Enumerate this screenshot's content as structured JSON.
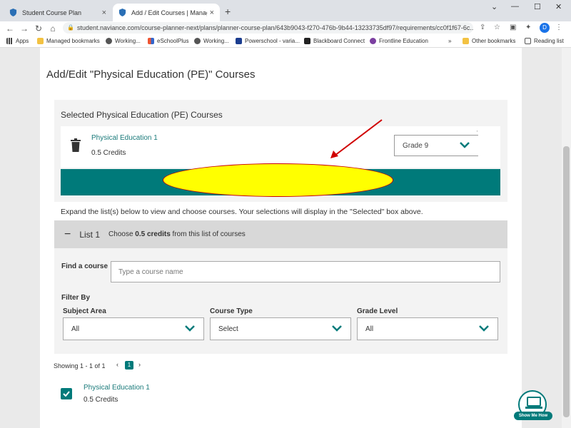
{
  "browser": {
    "tabs": [
      {
        "label": "Student Course Plan",
        "active": false
      },
      {
        "label": "Add / Edit Courses | Manage Co",
        "active": true
      }
    ],
    "new_tab_icon": "plus-icon",
    "url": "student.naviance.com/course-planner-next/plans/planner-course-plan/643b9043-f270-476b-9b44-13233735df97/requirements/cc0f1f67-6c...",
    "profile_initial": "D",
    "bookmarks": [
      "Apps",
      "Managed bookmarks",
      "Working...",
      "eSchoolPlus",
      "Working...",
      "Powerschool - varia...",
      "Blackboard Connect",
      "Frontline Education"
    ],
    "bookmarks_overflow": "»",
    "other_bookmarks": "Other bookmarks",
    "reading_list": "Reading list"
  },
  "page": {
    "title": "Add/Edit \"Physical Education (PE)\" Courses",
    "selected": {
      "heading": "Selected Physical Education (PE) Courses",
      "course_name": "Physical Education 1",
      "course_credits": "0.5 Credits",
      "grade_value": "Grade 9"
    },
    "instructions": "Expand the list(s) below to view and choose courses. Your selections will display in the \"Selected\" box above.",
    "list": {
      "collapse_symbol": "−",
      "name": "List 1",
      "desc_prefix": "Choose",
      "desc_bold": "0.5 credits",
      "desc_suffix": "from this list of courses"
    },
    "find": {
      "label": "Find a course",
      "placeholder": "Type a course name"
    },
    "filter": {
      "heading": "Filter By",
      "subject_label": "Subject Area",
      "subject_value": "All",
      "type_label": "Course Type",
      "type_value": "Select",
      "grade_label": "Grade Level",
      "grade_value": "All"
    },
    "pagination": {
      "showing": "Showing 1 - 1 of 1",
      "prev": "‹",
      "current": "1",
      "next": "›"
    },
    "result": {
      "course_name": "Physical Education 1",
      "course_credits": "0.5 Credits",
      "checked": true
    },
    "show_me_how": "Show Me How"
  },
  "colors": {
    "teal": "#007a7a",
    "highlight_yellow": "#ffff00",
    "arrow_red": "#d00000"
  }
}
